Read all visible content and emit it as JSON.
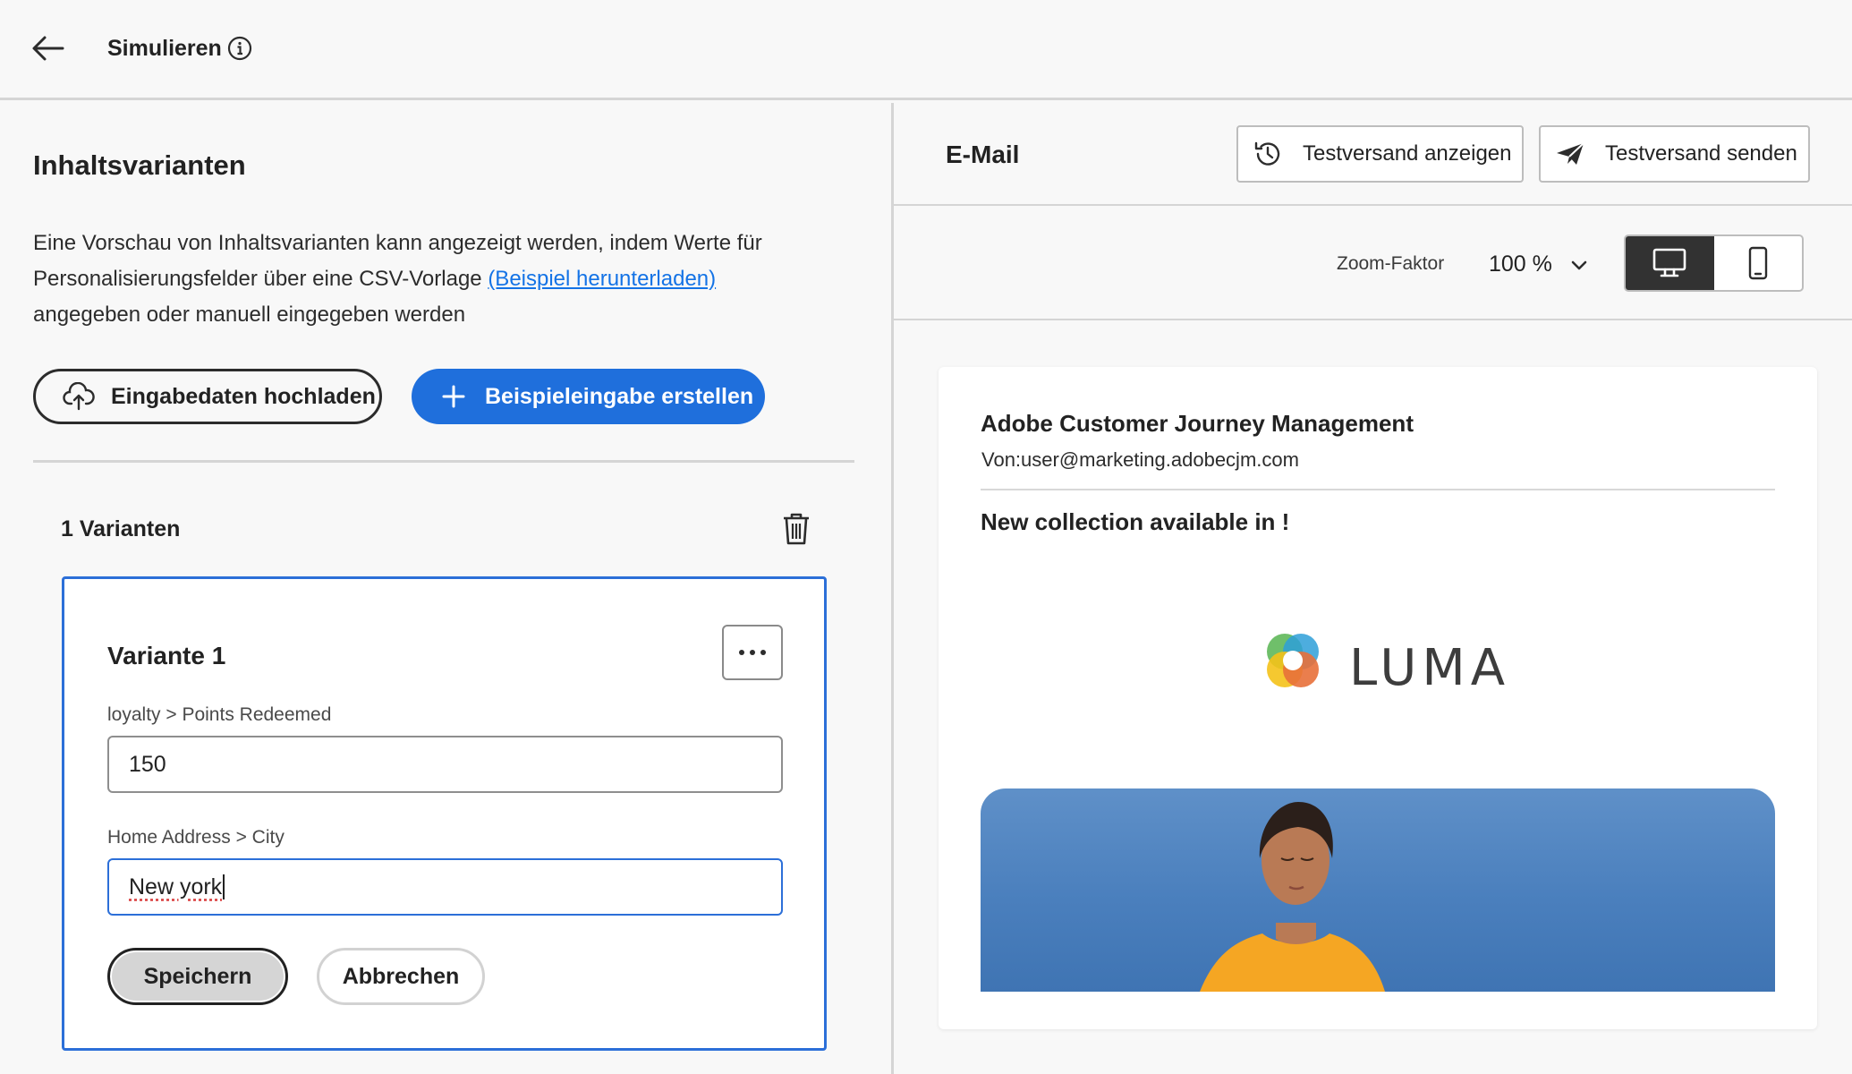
{
  "header": {
    "title": "Simulieren"
  },
  "left": {
    "section_title": "Inhaltsvarianten",
    "description_part1": "Eine Vorschau von Inhaltsvarianten kann angezeigt werden, indem Werte für Personalisierungsfelder über eine CSV-Vorlage ",
    "description_link": "(Beispiel herunterladen)",
    "description_part2": " angegeben oder manuell eingegeben werden",
    "upload_button": "Eingabedaten hochladen",
    "create_button": "Beispieleingabe erstellen",
    "variant_count": "1 Varianten",
    "variant": {
      "title": "Variante 1",
      "fields": [
        {
          "label": "loyalty > Points Redeemed",
          "value": "150"
        },
        {
          "label": "Home Address > City",
          "value": "New york"
        }
      ],
      "save_button": "Speichern",
      "cancel_button": "Abbrechen"
    }
  },
  "right": {
    "channel_label": "E-Mail",
    "show_proof_button": "Testversand anzeigen",
    "send_proof_button": "Testversand senden",
    "zoom_label": "Zoom-Faktor",
    "zoom_value": "100 %",
    "device_selected": "desktop",
    "preview": {
      "sender_name": "Adobe Customer Journey Management",
      "from_label": "Von:",
      "from_address": "user@marketing.adobecjm.com",
      "subject": "New collection available in !",
      "logo_text": "LUMA"
    }
  },
  "colors": {
    "accent": "#1f6fdc",
    "focus_border": "#2c6fd8",
    "link": "#1473e6"
  }
}
